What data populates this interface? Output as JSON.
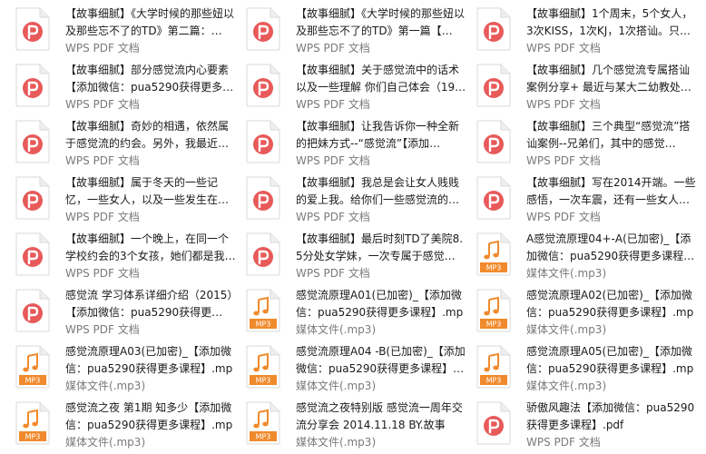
{
  "items": [
    {
      "name": "【故事细腻】《大学时候的那些妞以及那些忘不了的TD》第二篇：…",
      "type": "WPS PDF 文档",
      "icon": "pdf-icon"
    },
    {
      "name": "【故事细腻】《大学时候的那些妞以及那些忘不了的TD》第一篇【…",
      "type": "WPS PDF 文档",
      "icon": "pdf-icon"
    },
    {
      "name": "【故事细腻】1个周末，5个女人，3次KISS，1次KJ，1次搭讪。只…",
      "type": "WPS PDF 文档",
      "icon": "pdf-icon"
    },
    {
      "name": "【故事细腻】部分感觉流内心要素【添加微信：pua5290获得更多…",
      "type": "WPS PDF 文档",
      "icon": "pdf-icon"
    },
    {
      "name": "【故事细腻】关于感觉流中的话术以及一些理解 你们自己体会（19…",
      "type": "WPS PDF 文档",
      "icon": "pdf-icon"
    },
    {
      "name": "【故事细腻】几个感觉流专属搭讪案例分享+ 最近与某大二幼教处…",
      "type": "WPS PDF 文档",
      "icon": "pdf-icon"
    },
    {
      "name": "【故事细腻】奇妙的相遇，依然属于感觉流的约会。另外，我最近…",
      "type": "WPS PDF 文档",
      "icon": "pdf-icon"
    },
    {
      "name": "【故事细腻】让我告诉你一种全新的把妹方式--“感觉流”【添加…",
      "type": "WPS PDF 文档",
      "icon": "pdf-icon"
    },
    {
      "name": "【故事细腻】三个典型“感觉流”搭讪案例--兄弟们，其中的感觉…",
      "type": "WPS PDF 文档",
      "icon": "pdf-icon"
    },
    {
      "name": "【故事细腻】属于冬天的一些记忆，一些女人，以及一些发生在…",
      "type": "WPS PDF 文档",
      "icon": "pdf-icon"
    },
    {
      "name": "【故事细腻】我总是会让女人贱贱的爱上我。给你们一些感觉流的…",
      "type": "WPS PDF 文档",
      "icon": "pdf-icon"
    },
    {
      "name": "【故事细腻】写在2014开端。一些感悟，一次车震，还有一些女人…",
      "type": "WPS PDF 文档",
      "icon": "pdf-icon"
    },
    {
      "name": "【故事细腻】一个晚上，在同一个学校约会的3个女孩，她们都是我…",
      "type": "WPS PDF 文档",
      "icon": "pdf-icon"
    },
    {
      "name": "【故事细腻】最后时刻TD了美院8.5分处女学妹，一次专属于感觉…",
      "type": "WPS PDF 文档",
      "icon": "pdf-icon"
    },
    {
      "name": "A感觉流原理04+-A(已加密)_【添加微信：pua5290获得更多课程…",
      "type": "媒体文件(.mp3)",
      "icon": "mp3-icon"
    },
    {
      "name": "感觉流 学习体系详细介绍（2015）【添加微信：pua5290获得更…",
      "type": "WPS PDF 文档",
      "icon": "pdf-icon"
    },
    {
      "name": "感觉流原理A01(已加密)_【添加微信：pua5290获得更多课程】.mp3",
      "type": "媒体文件(.mp3)",
      "icon": "mp3-icon"
    },
    {
      "name": "感觉流原理A02(已加密)_【添加微信：pua5290获得更多课程】.mp3",
      "type": "媒体文件(.mp3)",
      "icon": "mp3-icon"
    },
    {
      "name": "感觉流原理A03(已加密)_【添加微信：pua5290获得更多课程】.mp3",
      "type": "媒体文件(.mp3)",
      "icon": "mp3-icon"
    },
    {
      "name": "感觉流原理A04 -B(已加密)_【添加微信：pua5290获得更多课程】…",
      "type": "媒体文件(.mp3)",
      "icon": "mp3-icon"
    },
    {
      "name": "感觉流原理A05(已加密)_【添加微信：pua5290获得更多课程】.mp3",
      "type": "媒体文件(.mp3)",
      "icon": "mp3-icon"
    },
    {
      "name": "感觉流之夜 第1期 知多少【添加微信：pua5290获得更多课程】.mp3",
      "type": "媒体文件(.mp3)",
      "icon": "mp3-icon"
    },
    {
      "name": "感觉流之夜特别版 感觉流一周年交流分享会 2014.11.18 BY.故事细…",
      "type": "媒体文件(.mp3)",
      "icon": "mp3-icon"
    },
    {
      "name": "骄傲风趣法【添加微信：pua5290获得更多课程】.pdf",
      "type": "WPS PDF 文档",
      "icon": "pdf-icon"
    }
  ],
  "icons": {
    "pdf_color": "#e85a5a",
    "mp3_color": "#f08a2c",
    "mp3_label": "MP3"
  }
}
